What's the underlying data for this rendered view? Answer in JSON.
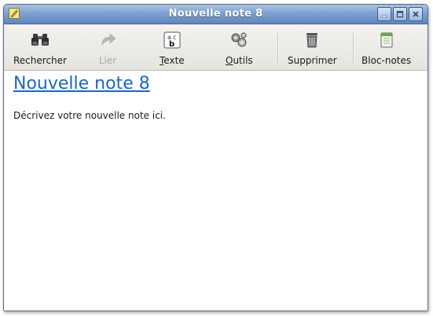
{
  "window": {
    "title": "Nouvelle note 8",
    "buttons": [
      "minimize",
      "maximize",
      "close"
    ]
  },
  "toolbar": {
    "items": [
      {
        "label": "Rechercher",
        "icon": "binoculars-icon",
        "enabled": true
      },
      {
        "label": "Lier",
        "icon": "link-arrow-icon",
        "enabled": false
      },
      {
        "label_mnemonic": "T",
        "label_rest": "exte",
        "icon": "text-style-icon",
        "enabled": true
      },
      {
        "label_mnemonic": "O",
        "label_rest": "utils",
        "icon": "gears-icon",
        "enabled": true
      },
      {
        "label": "Supprimer",
        "icon": "trash-icon",
        "enabled": true
      },
      {
        "label": "Bloc-notes",
        "icon": "notebook-icon",
        "enabled": true
      }
    ]
  },
  "note": {
    "title": "Nouvelle note 8",
    "body": "Décrivez votre nouvelle note ici."
  },
  "colors": {
    "title_link": "#1a66c9",
    "titlebar": "#7ea0cf"
  }
}
